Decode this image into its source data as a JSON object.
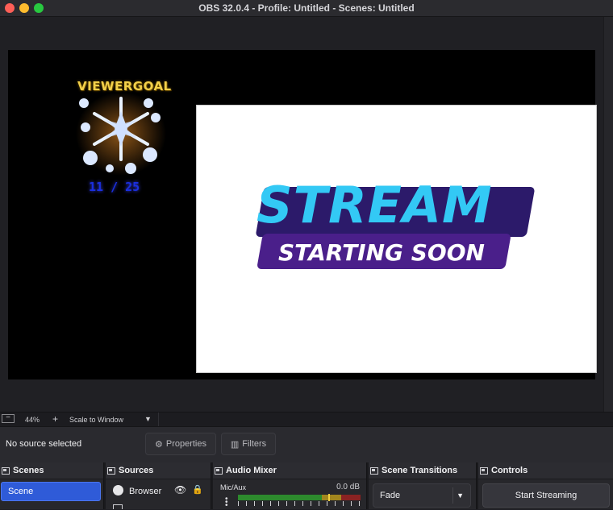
{
  "window": {
    "title": "OBS 32.0.4 - Profile: Untitled - Scenes: Untitled"
  },
  "preview": {
    "viewer_goal_title": "VIEWERGOAL",
    "viewer_goal_count": "11 / 25",
    "logo_line1": "STREAM",
    "logo_line2": "STARTING SOON"
  },
  "zoom": {
    "minus": "−",
    "percent": "44%",
    "plus": "+",
    "scale_mode": "Scale to Window"
  },
  "source_bar": {
    "status": "No source selected",
    "properties_label": "Properties",
    "filters_label": "Filters"
  },
  "docks": {
    "scenes": {
      "title": "Scenes",
      "items": [
        "Scene"
      ]
    },
    "sources": {
      "title": "Sources",
      "items": [
        {
          "name": "Browser",
          "icon": "globe-icon",
          "visible": true,
          "locked": true
        }
      ]
    },
    "audio_mixer": {
      "title": "Audio Mixer",
      "channel": "Mic/Aux",
      "level": "0.0 dB"
    },
    "scene_transitions": {
      "title": "Scene Transitions",
      "selected": "Fade"
    },
    "controls": {
      "title": "Controls",
      "start_streaming": "Start Streaming"
    }
  },
  "colors": {
    "accent_selected": "#2f5bd8",
    "traffic_red": "#fe5f57",
    "traffic_yellow": "#febc2e",
    "traffic_green": "#28c840"
  }
}
